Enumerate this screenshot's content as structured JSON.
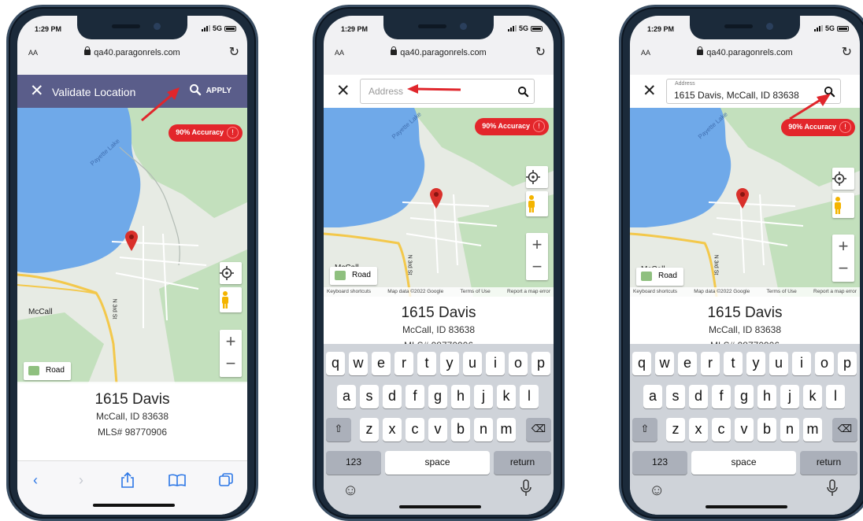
{
  "status": {
    "time": "1:29 PM",
    "network": "5G"
  },
  "browser": {
    "aa": "AA",
    "url": "qa40.paragonrels.com"
  },
  "header": {
    "title": "Validate Location",
    "apply": "APPLY"
  },
  "address_field": {
    "placeholder": "Address",
    "label": "Address",
    "value": "1615 Davis, McCall, ID 83638"
  },
  "accuracy": {
    "label": "90% Accuracy"
  },
  "map": {
    "lake_label": "Payette Lake",
    "town_label": "McCall",
    "road_label": "N 3rd St",
    "road_button": "Road",
    "attribution": {
      "shortcuts": "Keyboard shortcuts",
      "data": "Map data ©2022 Google",
      "terms": "Terms of Use",
      "report": "Report a map error"
    }
  },
  "property": {
    "street": "1615 Davis",
    "city_line": "McCall, ID 83638",
    "mls": "MLS# 98770906"
  },
  "keyboard": {
    "row1": [
      "q",
      "w",
      "e",
      "r",
      "t",
      "y",
      "u",
      "i",
      "o",
      "p"
    ],
    "row2": [
      "a",
      "s",
      "d",
      "f",
      "g",
      "h",
      "j",
      "k",
      "l"
    ],
    "row3": [
      "z",
      "x",
      "c",
      "v",
      "b",
      "n",
      "m"
    ],
    "numbers": "123",
    "space": "space",
    "return": "return"
  },
  "colors": {
    "header": "#5a5d8a",
    "accuracy": "#e3262b",
    "arrow": "#e0262c",
    "lake": "#6fa9e9",
    "land": "#e7ebe4",
    "forest": "#c3e0bd",
    "road": "#f3c84b"
  },
  "icons": [
    "close-icon",
    "search-icon",
    "lock-icon",
    "reload-icon",
    "info-icon",
    "map-pin-icon",
    "locate-icon",
    "pegman-icon",
    "zoom-in-icon",
    "zoom-out-icon",
    "back-icon",
    "forward-icon",
    "share-icon",
    "bookmarks-icon",
    "tabs-icon",
    "shift-icon",
    "backspace-icon",
    "emoji-icon",
    "microphone-icon"
  ]
}
